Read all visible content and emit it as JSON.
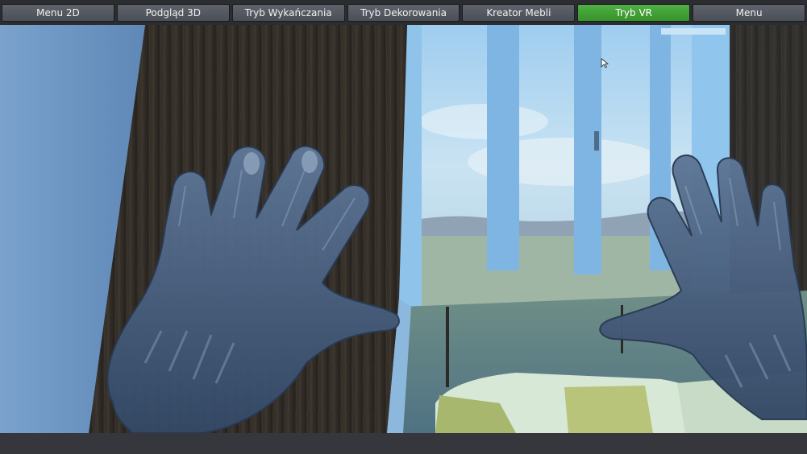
{
  "toolbar": {
    "buttons": [
      {
        "label": "Menu 2D",
        "active": false
      },
      {
        "label": "Podgląd 3D",
        "active": false
      },
      {
        "label": "Tryb Wykańczania",
        "active": false
      },
      {
        "label": "Tryb Dekorowania",
        "active": false
      },
      {
        "label": "Kreator Mebli",
        "active": false
      },
      {
        "label": "Tryb VR",
        "active": true
      },
      {
        "label": "Menu",
        "active": false
      }
    ]
  },
  "colors": {
    "active_button": "#44a338",
    "button": "#555961",
    "toolbar_bg": "#2b2d31",
    "glove": "#3f5370",
    "sky": "#a8d0ec",
    "wood": "#2c2a27",
    "wall": "#6f98c4"
  },
  "viewport": {
    "scene": "vr-room-view",
    "cursor": "mouse-pointer-icon"
  }
}
